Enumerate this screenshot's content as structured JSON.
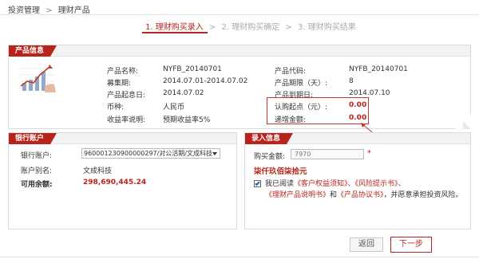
{
  "breadcrumb": {
    "parent": "投资管理",
    "separator": ">",
    "current": "理财产品"
  },
  "steps": {
    "step1": "1. 理财购买录入",
    "step2": "2. 理财购买确定",
    "step3": "3. 理财购买结果",
    "arrow": ">"
  },
  "product_panel": {
    "title": "产品信息",
    "fields": {
      "name_label": "产品名称:",
      "name_value": "NYFB_20140701",
      "code_label": "产品代码:",
      "code_value": "NYFB_20140701",
      "raise_label": "募集期:",
      "raise_value": "2014.07.01-2014.07.02",
      "term_label": "产品期限（天）:",
      "term_value": "8",
      "start_label": "产品起息日:",
      "start_value": "2014.07.02",
      "end_label": "产品到期日:",
      "end_value": "2014.07.10",
      "currency_label": "币种:",
      "currency_value": "人民币",
      "min_label": "认购起点（元）:",
      "min_value": "0.00",
      "yield_label": "收益率说明:",
      "yield_value": "预期收益率5%",
      "step_label": "递增金额:",
      "step_value": "0.00"
    }
  },
  "bank_panel": {
    "title": "银行账户",
    "account_label": "银行账户:",
    "account_selected": "960001230900000297/对公活期/文成科技",
    "alias_label": "账户别名:",
    "alias_value": "文成科技",
    "balance_label": "可用余额:",
    "balance_value": "298,690,445.24"
  },
  "entry_panel": {
    "title": "录入信息",
    "amount_label": "购买金额:",
    "amount_value": "7970",
    "required_mark": "*",
    "amount_in_words": "柒仟玖佰柒拾元",
    "agree_prefix": "我已阅读",
    "link1": "《客户权益须知》",
    "sep1": "、",
    "link2": "《风险提示书》",
    "sep2": "、",
    "link3": "《理财产品说明书》",
    "and": "和",
    "link4": "《产品协议书》",
    "agree_suffix": "，并愿意承担投资风险。",
    "agreed": true
  },
  "buttons": {
    "back": "返回",
    "next": "下一步"
  },
  "colors": {
    "accent": "#b8241b",
    "border": "#dcdcdc",
    "header_bg": "#f2f2f2"
  }
}
